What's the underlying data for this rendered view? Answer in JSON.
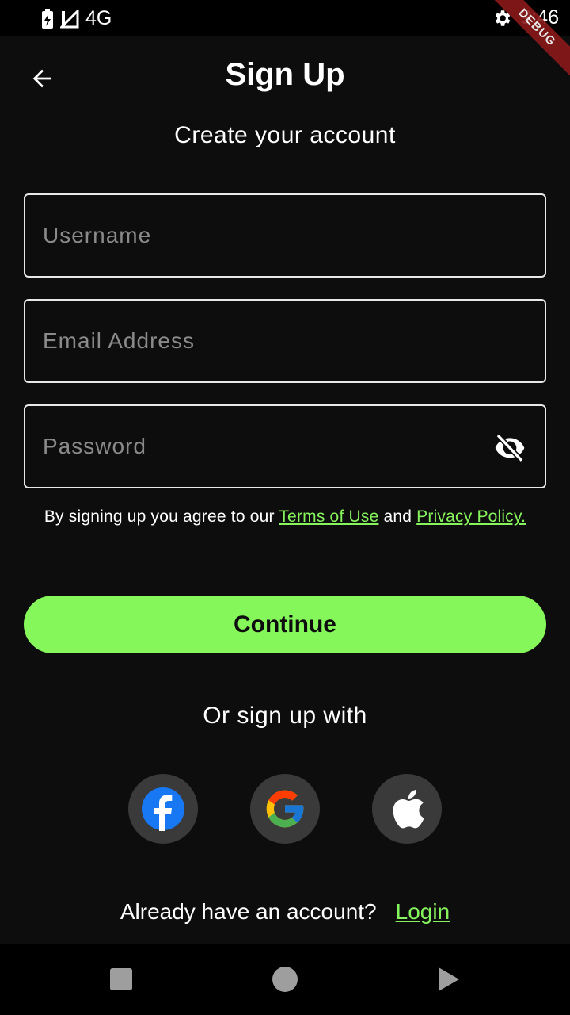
{
  "status_bar": {
    "network": "4G",
    "time": "9:46",
    "debug_label": "DEBUG"
  },
  "header": {
    "title": "Sign Up",
    "subtitle": "Create your account"
  },
  "form": {
    "username_placeholder": "Username",
    "username_value": "",
    "email_placeholder": "Email Address",
    "email_value": "",
    "password_placeholder": "Password",
    "password_value": ""
  },
  "terms": {
    "prefix": "By signing up you agree to our ",
    "terms_link": "Terms of Use",
    "middle": " and ",
    "privacy_link": "Privacy Policy."
  },
  "continue_label": "Continue",
  "social": {
    "heading": "Or sign up with",
    "providers": [
      "facebook-icon",
      "google-icon",
      "apple-icon"
    ]
  },
  "login": {
    "prompt": "Already have an account?",
    "link": "Login"
  },
  "colors": {
    "accent": "#86f75a",
    "background": "#0d0d0d",
    "debug": "#8b1a1a"
  }
}
